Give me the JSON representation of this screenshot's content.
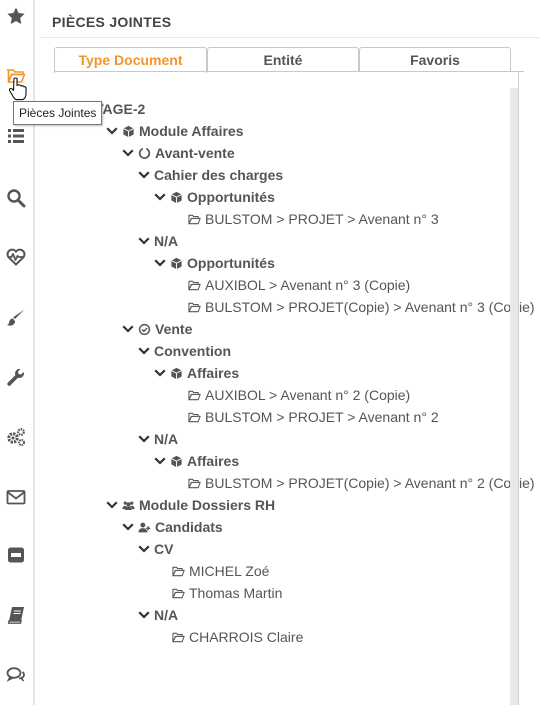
{
  "tooltip": "Pièces Jointes",
  "page": {
    "title": "PIÈCES JOINTES"
  },
  "tabs": [
    {
      "label": "Type Document",
      "active": true
    },
    {
      "label": "Entité",
      "active": false
    },
    {
      "label": "Favoris",
      "active": false
    }
  ],
  "colors": {
    "accent": "#f0962a",
    "text": "#555555",
    "icon": "#555555"
  },
  "sidebar_icons": [
    "star-icon",
    "folder-open-icon",
    "list-icon",
    "search-icon",
    "heartbeat-icon",
    "brush-icon",
    "wrench-icon",
    "gears-icon",
    "envelope-icon",
    "inbox-icon",
    "book-icon",
    "comments-icon"
  ],
  "tree": [
    {
      "label": "TAGE-2",
      "level": 0,
      "icon": "none",
      "expander": false,
      "bold": true
    },
    {
      "label": "Module Affaires",
      "level": 1,
      "icon": "cube-icon",
      "expander": true,
      "bold": true
    },
    {
      "label": "Avant-vente",
      "level": 2,
      "icon": "circle-notch-icon",
      "expander": true,
      "bold": true
    },
    {
      "label": "Cahier des charges",
      "level": 3,
      "icon": "none",
      "expander": true,
      "bold": true
    },
    {
      "label": "Opportunités",
      "level": 4,
      "icon": "cube-icon",
      "expander": true,
      "bold": true
    },
    {
      "label": "BULSTOM > PROJET > Avenant n° 3",
      "level": 5,
      "icon": "folder-icon",
      "expander": false,
      "bold": false
    },
    {
      "label": "N/A",
      "level": 3,
      "icon": "none",
      "expander": true,
      "bold": true
    },
    {
      "label": "Opportunités",
      "level": 4,
      "icon": "cube-icon",
      "expander": true,
      "bold": true
    },
    {
      "label": "AUXIBOL > Avenant n° 3 (Copie)",
      "level": 5,
      "icon": "folder-icon",
      "expander": false,
      "bold": false
    },
    {
      "label": "BULSTOM > PROJET(Copie) > Avenant n° 3 (Copie)",
      "level": 5,
      "icon": "folder-icon",
      "expander": false,
      "bold": false
    },
    {
      "label": "Vente",
      "level": 2,
      "icon": "check-circle-icon",
      "expander": true,
      "bold": true
    },
    {
      "label": "Convention",
      "level": 3,
      "icon": "none",
      "expander": true,
      "bold": true
    },
    {
      "label": "Affaires",
      "level": 4,
      "icon": "cube-icon",
      "expander": true,
      "bold": true
    },
    {
      "label": "AUXIBOL > Avenant n° 2 (Copie)",
      "level": 5,
      "icon": "folder-icon",
      "expander": false,
      "bold": false
    },
    {
      "label": "BULSTOM > PROJET > Avenant n° 2",
      "level": 5,
      "icon": "folder-icon",
      "expander": false,
      "bold": false
    },
    {
      "label": "N/A",
      "level": 3,
      "icon": "none",
      "expander": true,
      "bold": true
    },
    {
      "label": "Affaires",
      "level": 4,
      "icon": "cube-icon",
      "expander": true,
      "bold": true
    },
    {
      "label": "BULSTOM > PROJET(Copie) > Avenant n° 2 (Copie)",
      "level": 5,
      "icon": "folder-icon",
      "expander": false,
      "bold": false
    },
    {
      "label": "Module Dossiers RH",
      "level": 1,
      "icon": "users-icon",
      "expander": true,
      "bold": true
    },
    {
      "label": "Candidats",
      "level": 2,
      "icon": "user-plus-icon",
      "expander": true,
      "bold": true
    },
    {
      "label": "CV",
      "level": 3,
      "icon": "none",
      "expander": true,
      "bold": true
    },
    {
      "label": "MICHEL Zoé",
      "level": 4,
      "icon": "folder-icon",
      "expander": false,
      "bold": false
    },
    {
      "label": "Thomas Martin",
      "level": 4,
      "icon": "folder-icon",
      "expander": false,
      "bold": false
    },
    {
      "label": "N/A",
      "level": 3,
      "icon": "none",
      "expander": true,
      "bold": true
    },
    {
      "label": "CHARROIS Claire",
      "level": 4,
      "icon": "folder-icon",
      "expander": false,
      "bold": false
    }
  ]
}
